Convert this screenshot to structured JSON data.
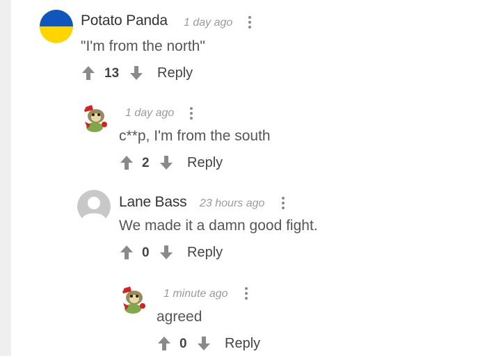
{
  "comments": [
    {
      "author": "Potato Panda",
      "time": "1 day ago",
      "text": "\"I'm from the north\"",
      "score": "13",
      "reply_label": "Reply",
      "avatar_icon": "ukraine-flag-avatar"
    },
    {
      "author": "",
      "time": "1 day ago",
      "text": "c**p, I'm from the south",
      "score": "2",
      "reply_label": "Reply",
      "avatar_icon": "monkey-santa-avatar"
    },
    {
      "author": "Lane Bass",
      "time": "23 hours ago",
      "text": "We made it a damn good fight.",
      "score": "0",
      "reply_label": "Reply",
      "avatar_icon": "default-user-avatar"
    },
    {
      "author": "",
      "time": "1 minute ago",
      "text": "agreed",
      "score": "0",
      "reply_label": "Reply",
      "avatar_icon": "monkey-santa-avatar"
    }
  ],
  "colors": {
    "flag_blue": "#0f57bd",
    "flag_yellow": "#ffd500",
    "icon_gray": "#8a8a8a",
    "text": "#555555"
  }
}
